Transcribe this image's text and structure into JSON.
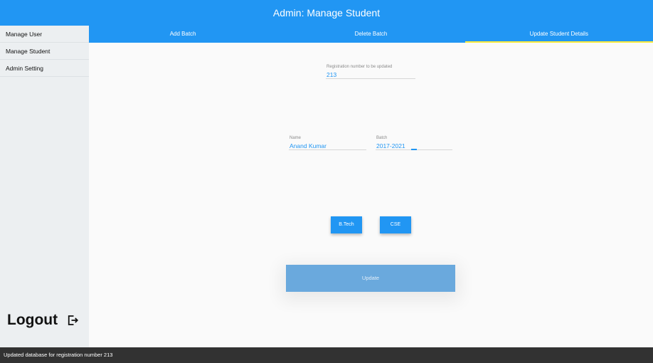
{
  "appbar": {
    "title": "Admin: Manage Student"
  },
  "sidebar": {
    "items": [
      {
        "label": "Manage User"
      },
      {
        "label": "Manage Student"
      },
      {
        "label": "Admin Setting"
      }
    ],
    "logout_label": "Logout"
  },
  "tabs": [
    {
      "label": "Add Batch",
      "active": false
    },
    {
      "label": "Delete Batch",
      "active": false
    },
    {
      "label": "Update Student Details",
      "active": true
    }
  ],
  "form": {
    "registration": {
      "label": "Registration number to be updated",
      "value": "213"
    },
    "name": {
      "label": "Name",
      "value": "Anand Kumar"
    },
    "batch": {
      "label": "Batch",
      "value": "2017-2021"
    },
    "course_button": "B.Tech",
    "branch_button": "CSE",
    "update_button": "Update"
  },
  "snackbar": {
    "message": "Updated database for registration number 213"
  },
  "colors": {
    "primary": "#2196f3",
    "tab_indicator": "#ffeb3b",
    "update_button": "#6aa9dd",
    "snackbar": "#323232"
  }
}
